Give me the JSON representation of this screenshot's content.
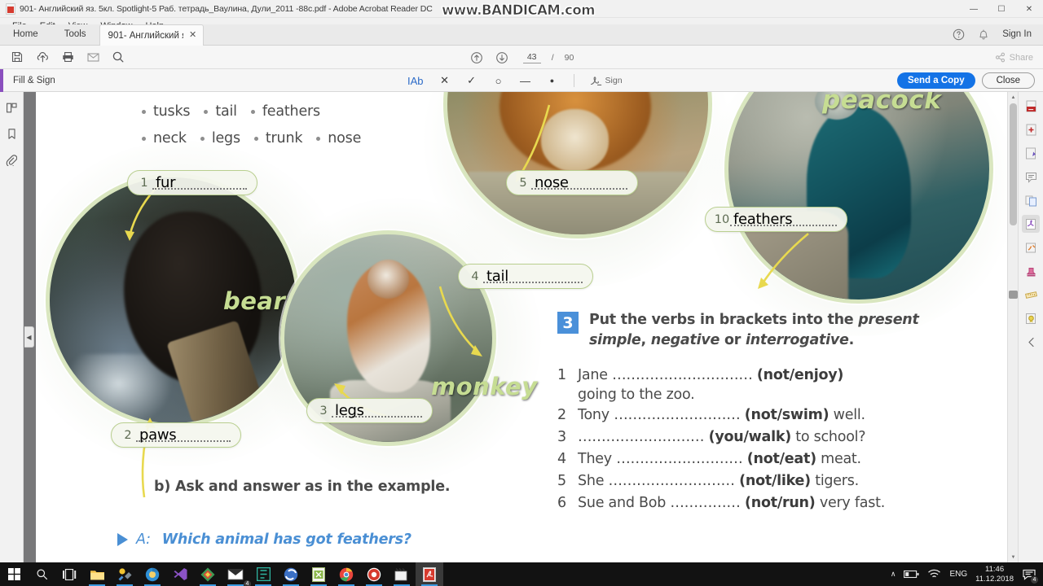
{
  "window": {
    "title": "901- Английский яз. 5кл. Spotlight-5 Раб. тетрадь_Ваулина, Дули_2011 -88c.pdf - Adobe Acrobat Reader DC",
    "minimize": "—",
    "maximize": "☐",
    "close": "✕"
  },
  "watermark": "www.BANDICAM.com",
  "menubar": {
    "items": [
      "File",
      "Edit",
      "View",
      "Window",
      "Help"
    ]
  },
  "tabstrip": {
    "home": "Home",
    "tools": "Tools",
    "doc_tab": "901- Английский я...",
    "doc_tab_close": "✕",
    "help_icon": "help-circle-icon",
    "bell_icon": "bell-icon",
    "signin": "Sign In"
  },
  "toolbar": {
    "icons": [
      "save-icon",
      "upload-cloud-icon",
      "print-icon",
      "email-icon",
      "search-icon"
    ],
    "page_up_icon": "page-up-icon",
    "page_down_icon": "page-down-icon",
    "current_page": "43",
    "page_separator": "/",
    "total_pages": "90",
    "share_label": "Share",
    "share_icon": "share-icon"
  },
  "fillsign": {
    "title": "Fill & Sign",
    "tools": [
      {
        "name": "text-tool",
        "glyph": "IAb",
        "active": true
      },
      {
        "name": "cross-tool",
        "glyph": "✕",
        "active": false
      },
      {
        "name": "checkmark-tool",
        "glyph": "✓",
        "active": false
      },
      {
        "name": "circle-tool",
        "glyph": "○",
        "active": false
      },
      {
        "name": "line-tool",
        "glyph": "—",
        "active": false
      },
      {
        "name": "dot-tool",
        "glyph": "●",
        "active": false
      }
    ],
    "sign_label": "Sign",
    "sign_icon": "signature-icon",
    "send_copy": "Send a Copy",
    "close": "Close"
  },
  "leftrail": {
    "icons": [
      "page-thumbnails-icon",
      "bookmark-icon",
      "attachment-icon"
    ],
    "collapse_glyph": "◀"
  },
  "rightrail": {
    "icons": [
      "export-pdf-icon",
      "create-pdf-icon",
      "edit-pdf-icon",
      "comment-icon",
      "combine-files-icon",
      "fill-sign-icon",
      "send-for-signature-icon",
      "stamp-icon",
      "measure-icon",
      "certificates-icon",
      "more-tools-icon"
    ]
  },
  "scrollbar": {
    "up_glyph": "▲",
    "down_glyph": "▼"
  },
  "document": {
    "wordbank": {
      "row1": [
        "tusks",
        "tail",
        "feathers"
      ],
      "row2": [
        "neck",
        "legs",
        "trunk",
        "nose"
      ]
    },
    "animals": [
      {
        "name": "bear",
        "label": "bear"
      },
      {
        "name": "monkey",
        "label": "monkey"
      },
      {
        "name": "peacock",
        "label": "peacock"
      }
    ],
    "answers": [
      {
        "num": "1",
        "value": "fur"
      },
      {
        "num": "2",
        "value": "paws"
      },
      {
        "num": "3",
        "value": "legs"
      },
      {
        "num": "4",
        "value": "tail"
      },
      {
        "num": "5",
        "value": "nose"
      },
      {
        "num": "10",
        "value": "feathers"
      }
    ],
    "part_b": "b) Ask and answer as in the example.",
    "example": {
      "speaker": "A:",
      "question": "Which animal has got feathers?"
    },
    "exercise3": {
      "number": "3",
      "instruction_1": "Put the verbs in brackets into the ",
      "instruction_italic_1": "present simple",
      "instruction_2": ", ",
      "instruction_italic_2": "negative",
      "instruction_3": " or ",
      "instruction_italic_3": "interrogative",
      "instruction_4": ".",
      "items": [
        {
          "num": "1",
          "pre": "Jane ",
          "dots": "…………………………",
          "verb": "(not/enjoy)",
          "post": "",
          "cont": "going to the zoo."
        },
        {
          "num": "2",
          "pre": "Tony ",
          "dots": "………………………",
          "verb": "(not/swim)",
          "post": " well.",
          "cont": ""
        },
        {
          "num": "3",
          "pre": "",
          "dots": "………………………",
          "verb": "(you/walk)",
          "post": " to school?",
          "cont": ""
        },
        {
          "num": "4",
          "pre": "They ",
          "dots": "………………………",
          "verb": "(not/eat)",
          "post": " meat.",
          "cont": ""
        },
        {
          "num": "5",
          "pre": "She ",
          "dots": "………………………",
          "verb": "(not/like)",
          "post": " tigers.",
          "cont": ""
        },
        {
          "num": "6",
          "pre": "Sue and Bob ",
          "dots": "……………",
          "verb": "(not/run)",
          "post": " very fast.",
          "cont": ""
        }
      ]
    }
  },
  "taskbar": {
    "items": [
      "windows-start-icon",
      "search-icon",
      "task-view-icon",
      "file-explorer-icon",
      "settings-tools-icon",
      "chrome-blue-icon",
      "visual-studio-icon",
      "directory-opus-icon",
      "mail-icon",
      "evernote-icon",
      "skype-icon",
      "excel-icon",
      "chrome-icon",
      "record-icon",
      "movie-maker-icon",
      "acrobat-reader-icon"
    ],
    "mail_badge": "4",
    "tray": {
      "chevron_up": "∧",
      "battery_icon": "battery-icon",
      "wifi_icon": "wifi-icon",
      "language": "ENG",
      "time": "11:46",
      "date": "11.12.2018",
      "action_center_icon": "action-center-icon",
      "action_badge": "4"
    }
  },
  "colors": {
    "accent_blue": "#1473e6",
    "fillsign_purple": "#8a4fbe",
    "exercise_num_blue": "#4a90d9",
    "example_blue": "#4a8fd4",
    "pill_border": "#b9cf8f",
    "animal_name_green": "#c6dd93"
  }
}
